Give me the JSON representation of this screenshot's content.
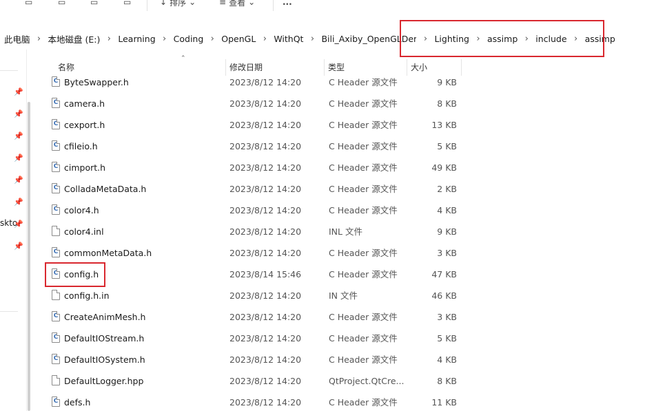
{
  "toolbar": {
    "sort_label": "排序",
    "view_label": "查看",
    "more_label": "..."
  },
  "breadcrumb": [
    "此电脑",
    "本地磁盘 (E:)",
    "Learning",
    "Coding",
    "OpenGL",
    "WithQt",
    "Bili_Axiby_OpenGLDemo",
    "Lighting",
    "assimp",
    "include",
    "assimp"
  ],
  "left_pane": {
    "partial_label": "skto"
  },
  "columns": {
    "name": "名称",
    "date": "修改日期",
    "type": "类型",
    "size": "大小"
  },
  "files": [
    {
      "name": "ByteSwapper.h",
      "date": "2023/8/12 14:20",
      "type": "C Header 源文件",
      "size": "9 KB",
      "icon": "c-header-icon"
    },
    {
      "name": "camera.h",
      "date": "2023/8/12 14:20",
      "type": "C Header 源文件",
      "size": "8 KB",
      "icon": "c-header-icon"
    },
    {
      "name": "cexport.h",
      "date": "2023/8/12 14:20",
      "type": "C Header 源文件",
      "size": "13 KB",
      "icon": "c-header-icon"
    },
    {
      "name": "cfileio.h",
      "date": "2023/8/12 14:20",
      "type": "C Header 源文件",
      "size": "5 KB",
      "icon": "c-header-icon"
    },
    {
      "name": "cimport.h",
      "date": "2023/8/12 14:20",
      "type": "C Header 源文件",
      "size": "49 KB",
      "icon": "c-header-icon"
    },
    {
      "name": "ColladaMetaData.h",
      "date": "2023/8/12 14:20",
      "type": "C Header 源文件",
      "size": "2 KB",
      "icon": "c-header-icon"
    },
    {
      "name": "color4.h",
      "date": "2023/8/12 14:20",
      "type": "C Header 源文件",
      "size": "4 KB",
      "icon": "c-header-icon"
    },
    {
      "name": "color4.inl",
      "date": "2023/8/12 14:20",
      "type": "INL 文件",
      "size": "9 KB",
      "icon": "file-icon"
    },
    {
      "name": "commonMetaData.h",
      "date": "2023/8/12 14:20",
      "type": "C Header 源文件",
      "size": "3 KB",
      "icon": "c-header-icon"
    },
    {
      "name": "config.h",
      "date": "2023/8/14 15:46",
      "type": "C Header 源文件",
      "size": "47 KB",
      "icon": "c-header-icon"
    },
    {
      "name": "config.h.in",
      "date": "2023/8/12 14:20",
      "type": "IN 文件",
      "size": "46 KB",
      "icon": "file-icon"
    },
    {
      "name": "CreateAnimMesh.h",
      "date": "2023/8/12 14:20",
      "type": "C Header 源文件",
      "size": "3 KB",
      "icon": "c-header-icon"
    },
    {
      "name": "DefaultIOStream.h",
      "date": "2023/8/12 14:20",
      "type": "C Header 源文件",
      "size": "5 KB",
      "icon": "c-header-icon"
    },
    {
      "name": "DefaultIOSystem.h",
      "date": "2023/8/12 14:20",
      "type": "C Header 源文件",
      "size": "4 KB",
      "icon": "c-header-icon"
    },
    {
      "name": "DefaultLogger.hpp",
      "date": "2023/8/12 14:20",
      "type": "QtProject.QtCre...",
      "size": "8 KB",
      "icon": "file-icon"
    },
    {
      "name": "defs.h",
      "date": "2023/8/12 14:20",
      "type": "C Header 源文件",
      "size": "11 KB",
      "icon": "c-header-icon"
    }
  ],
  "colors": {
    "highlight_red": "#d9272e",
    "header_text": "#333333",
    "muted_text": "#555555"
  }
}
